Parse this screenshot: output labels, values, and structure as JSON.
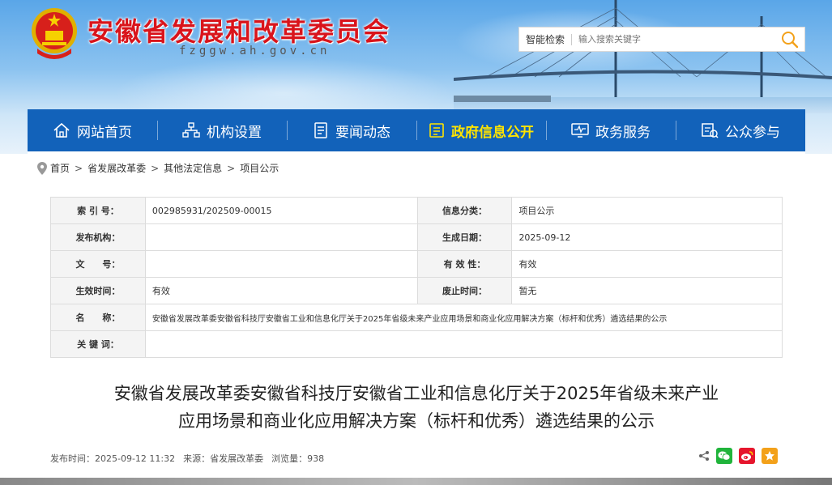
{
  "site": {
    "title": "安徽省发展和改革委员会",
    "domain": "fzggw.ah.gov.cn"
  },
  "search": {
    "label": "智能检索",
    "placeholder": "输入搜索关键字"
  },
  "nav": {
    "items": [
      {
        "label": "网站首页",
        "icon": "home-icon"
      },
      {
        "label": "机构设置",
        "icon": "org-chart-icon"
      },
      {
        "label": "要闻动态",
        "icon": "document-icon"
      },
      {
        "label": "政府信息公开",
        "icon": "info-list-icon",
        "active": true
      },
      {
        "label": "政务服务",
        "icon": "monitor-icon"
      },
      {
        "label": "公众参与",
        "icon": "feedback-icon"
      }
    ]
  },
  "breadcrumb": {
    "items": [
      "首页",
      "省发展改革委",
      "其他法定信息",
      "项目公示"
    ],
    "separator": ">"
  },
  "meta": {
    "index_label": "索 引 号：",
    "index_value": "002985931/202509-00015",
    "category_label": "信息分类：",
    "category_value": "项目公示",
    "publisher_label": "发布机构：",
    "publisher_value": "",
    "created_label": "生成日期：",
    "created_value": "2025-09-12",
    "docno_label": "文　　号：",
    "docno_value": "",
    "validity_label": "有 效 性：",
    "validity_value": "有效",
    "effective_label": "生效时间：",
    "effective_value": "有效",
    "abolish_label": "废止时间：",
    "abolish_value": "暂无",
    "name_label": "名　　称：",
    "name_value": "安徽省发展改革委安徽省科技厅安徽省工业和信息化厅关于2025年省级未来产业应用场景和商业化应用解决方案（标杆和优秀）遴选结果的公示",
    "keywords_label": "关 键 词：",
    "keywords_value": ""
  },
  "article": {
    "title_line1": "安徽省发展改革委安徽省科技厅安徽省工业和信息化厅关于2025年省级未来产业",
    "title_line2": "应用场景和商业化应用解决方案（标杆和优秀）遴选结果的公示",
    "publish_time": "发布时间：2025-09-12 11:32",
    "source": "来源：省发展改革委",
    "views": "浏览量：938"
  },
  "colors": {
    "nav_bg": "#1262ba",
    "nav_active": "#ffe400",
    "title_red": "#d9141b",
    "wechat": "#20b43b",
    "weibo": "#e6162d",
    "favorite": "#f3a11a"
  }
}
